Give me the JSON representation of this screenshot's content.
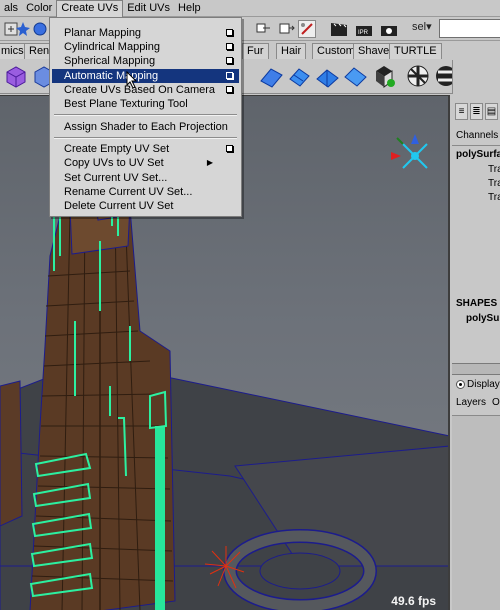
{
  "menubar": {
    "items": [
      {
        "label": "als"
      },
      {
        "label": "Color"
      },
      {
        "label": "Create UVs"
      },
      {
        "label": "Edit UVs"
      },
      {
        "label": "Help"
      }
    ]
  },
  "statusline": {
    "selection_mode": "sel",
    "search_value": ""
  },
  "shelf_tabs": [
    "mics",
    "Rend",
    "Fur",
    "Hair",
    "Custom",
    "Shave",
    "TURTLE"
  ],
  "create_uvs_menu": {
    "items": [
      {
        "label": "Planar Mapping",
        "option_box": true
      },
      {
        "label": "Cylindrical Mapping",
        "option_box": true
      },
      {
        "label": "Spherical Mapping",
        "option_box": true
      },
      {
        "label": "Automatic Mapping",
        "option_box": true,
        "highlighted": true
      },
      {
        "label": "Create UVs Based On Camera",
        "option_box": true
      },
      {
        "label": "Best Plane Texturing Tool",
        "option_box": false
      },
      {
        "label": "Assign Shader to Each Projection",
        "option_box": false
      },
      {
        "label": "Create Empty UV Set",
        "option_box": true
      },
      {
        "label": "Copy UVs to UV Set",
        "submenu": true
      },
      {
        "label": "Set Current UV Set..."
      },
      {
        "label": "Rename Current UV Set..."
      },
      {
        "label": "Delete Current UV Set"
      }
    ]
  },
  "viewport": {
    "fps": "49.6 fps",
    "accent_color": "#2cf0a0",
    "wire_color": "#1c1c8c"
  },
  "channel_box": {
    "channels_label": "Channels",
    "node_name": "polySurfa",
    "attributes": [
      "Tra",
      "Tra",
      "Tra"
    ],
    "shapes_label": "SHAPES",
    "shape_name": "polySu"
  },
  "layer_editor": {
    "display_label": "Display",
    "layers_label": "Layers",
    "options_label": "O"
  },
  "colors": {
    "menu_highlight": "#14357e",
    "ui_gray": "#c8c8c8"
  }
}
